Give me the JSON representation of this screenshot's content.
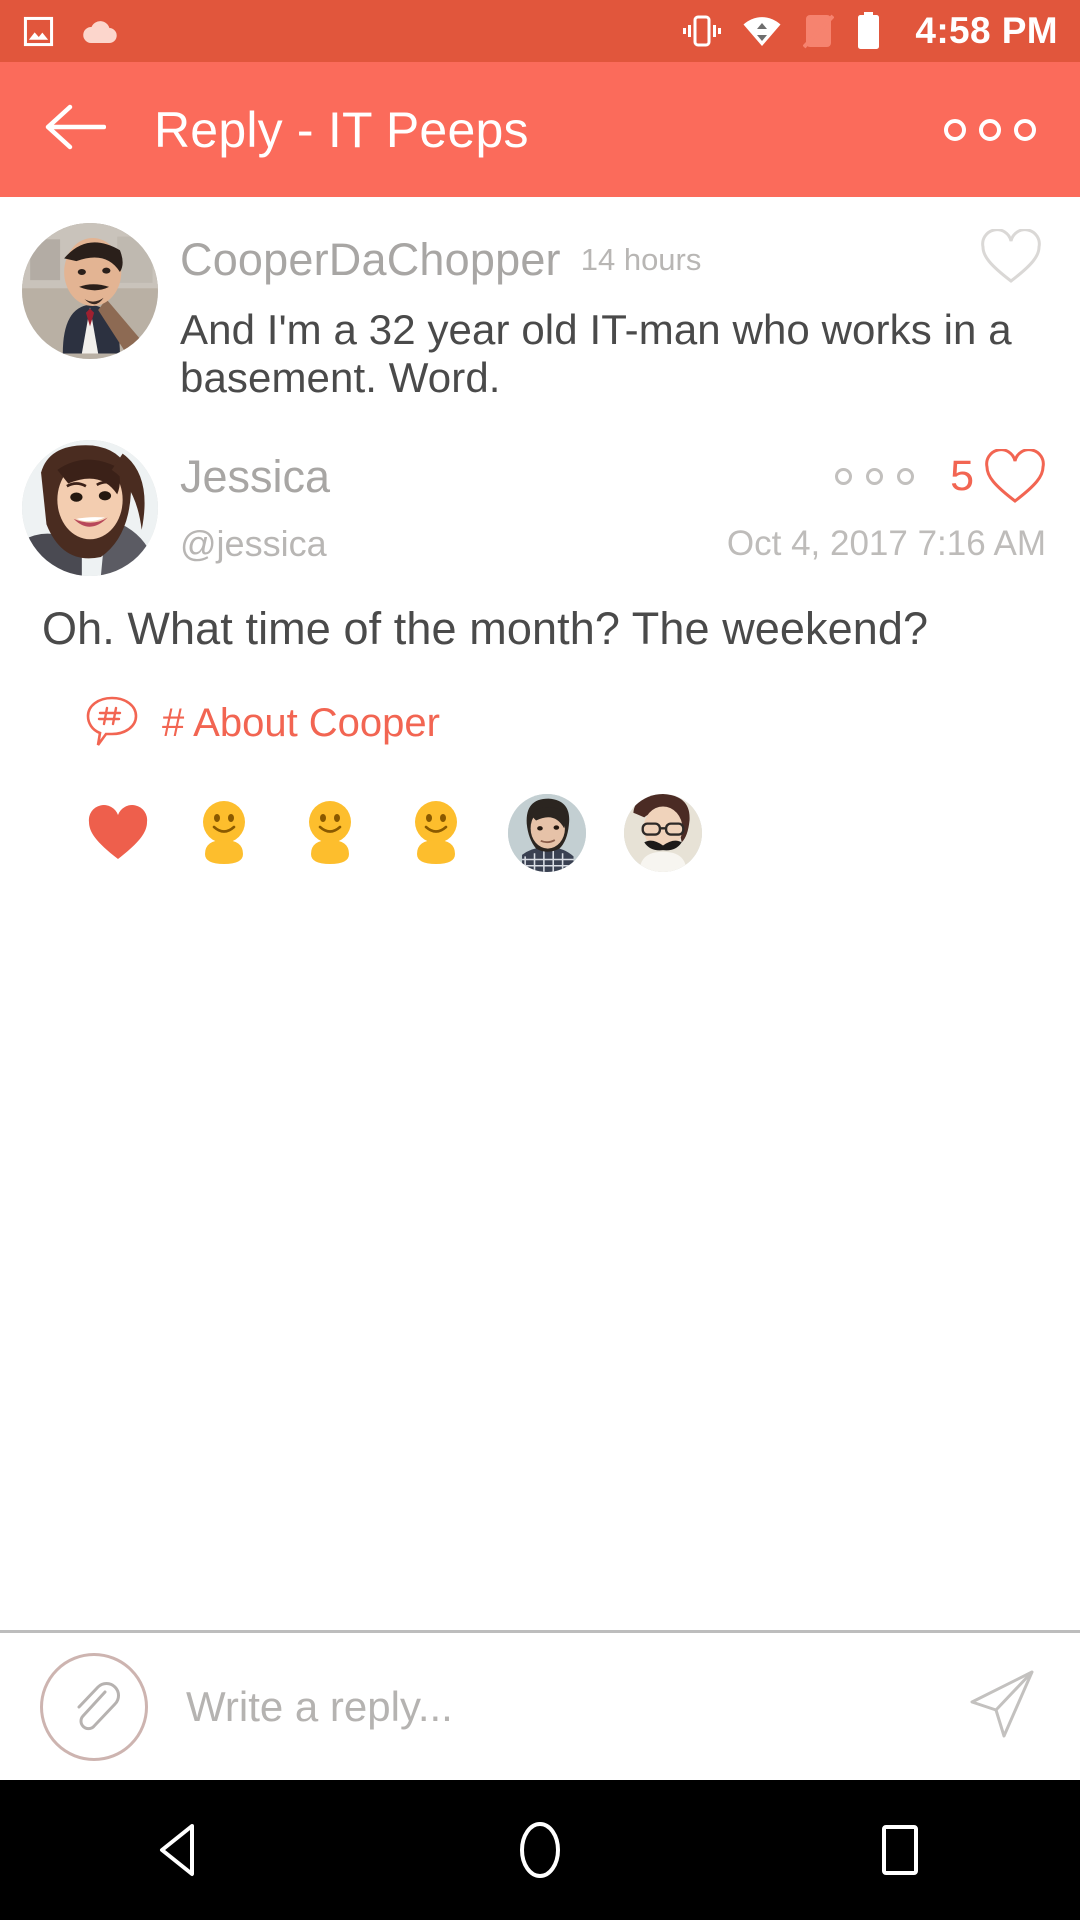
{
  "status_bar": {
    "time": "4:58 PM",
    "icons": [
      "image-icon",
      "cloud-icon",
      "vibrate-icon",
      "wifi-icon",
      "signal-off-icon",
      "battery-icon"
    ],
    "background": "#E1563C"
  },
  "app_bar": {
    "title": "Reply - IT Peeps",
    "back_icon": "arrow-left-icon",
    "overflow_icon": "overflow-menu-icon",
    "background": "#FB6B5B"
  },
  "messages": [
    {
      "id": "cooper-message",
      "username": "CooperDaChopper",
      "timestamp": "14 hours",
      "text": "And I'm a 32 year old IT-man who works in a basement. Word.",
      "like_icon": "heart-outline-icon",
      "like_color": "#D8D6D4",
      "avatar_alt": "cooper-avatar"
    },
    {
      "id": "jessica-message",
      "username": "Jessica",
      "handle": "@jessica",
      "timestamp": "Oct 4, 2017 7:16 AM",
      "text": "Oh. What time of the month? The weekend?",
      "like_count": "5",
      "like_icon": "heart-outline-icon",
      "like_color": "#F26552",
      "menu_icon": "overflow-menu-icon",
      "avatar_alt": "jessica-avatar"
    }
  ],
  "hashtag": {
    "icon": "hashtag-bubble-icon",
    "label": "# About Cooper",
    "color": "#F26552"
  },
  "reactions": [
    {
      "type": "heart",
      "name": "heart-filled-icon"
    },
    {
      "type": "placeholder",
      "name": "default-avatar-1"
    },
    {
      "type": "placeholder",
      "name": "default-avatar-2"
    },
    {
      "type": "placeholder",
      "name": "default-avatar-3"
    },
    {
      "type": "photo",
      "name": "reactor-avatar-1"
    },
    {
      "type": "photo",
      "name": "reactor-avatar-2"
    }
  ],
  "reply_bar": {
    "attach_icon": "paperclip-icon",
    "placeholder": "Write a reply...",
    "value": "",
    "send_icon": "send-icon"
  },
  "nav_bar": {
    "back": "nav-back-icon",
    "home": "nav-home-icon",
    "recents": "nav-recents-icon"
  },
  "colors": {
    "accent": "#F26552",
    "app_bar": "#FB6B5B",
    "status_bar": "#E1563C",
    "text_primary": "#4A4A4A",
    "text_muted": "#B8B6B4"
  }
}
